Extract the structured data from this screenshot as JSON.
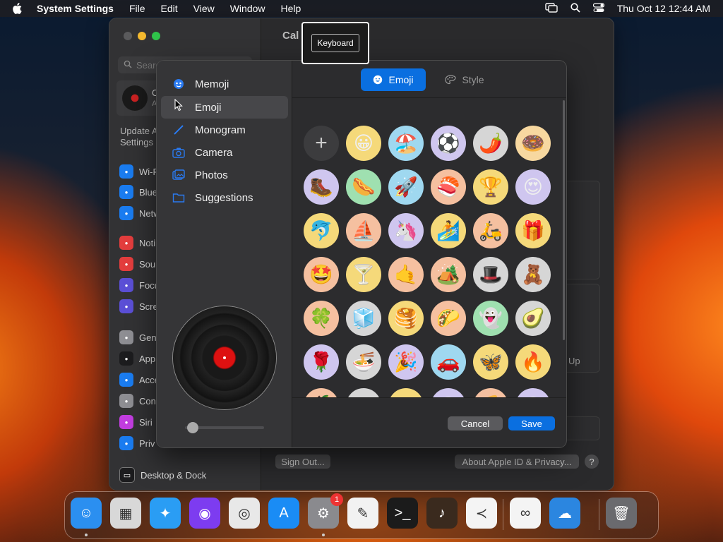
{
  "menubar": {
    "app_name": "System Settings",
    "menus": [
      "File",
      "Edit",
      "View",
      "Window",
      "Help"
    ],
    "datetime": "Thu Oct 12  12:44 AM"
  },
  "settings": {
    "search_placeholder": "Search",
    "content_title": "Cal",
    "profile_line1": "C",
    "profile_line2": "A",
    "update_text": "Update A Settings",
    "sidebar": [
      {
        "label": "Wi-F",
        "color": "#1a7cf0",
        "icon": "wifi-icon"
      },
      {
        "label": "Blue",
        "color": "#1a7cf0",
        "icon": "bluetooth-icon"
      },
      {
        "label": "Netw",
        "color": "#1a7cf0",
        "icon": "network-icon"
      },
      {
        "label": "Noti",
        "color": "#e33d3d",
        "icon": "notifications-icon"
      },
      {
        "label": "Sou",
        "color": "#e33d3d",
        "icon": "sound-icon"
      },
      {
        "label": "Focu",
        "color": "#5b4fd6",
        "icon": "focus-icon"
      },
      {
        "label": "Scre",
        "color": "#5b4fd6",
        "icon": "screen-time-icon"
      },
      {
        "label": "Gen",
        "color": "#8e8e93",
        "icon": "general-icon"
      },
      {
        "label": "App",
        "color": "#1c1c1e",
        "icon": "appearance-icon"
      },
      {
        "label": "Acce",
        "color": "#1a7cf0",
        "icon": "accessibility-icon"
      },
      {
        "label": "Con",
        "color": "#8e8e93",
        "icon": "control-center-icon"
      },
      {
        "label": "Siri",
        "color": "#c23de0",
        "icon": "siri-icon"
      },
      {
        "label": "Priv",
        "color": "#1a7cf0",
        "icon": "privacy-icon"
      }
    ],
    "desktop_dock": "Desktop & Dock",
    "up_text": "Up",
    "sign_out": "Sign Out...",
    "about": "About Apple ID & Privacy...",
    "help": "?"
  },
  "tooltip": {
    "label": "Keyboard"
  },
  "dialog": {
    "categories": [
      {
        "label": "Memoji",
        "icon": "memoji-icon",
        "selected": false
      },
      {
        "label": "Emoji",
        "icon": "emoji-icon",
        "selected": true
      },
      {
        "label": "Monogram",
        "icon": "monogram-icon",
        "selected": false
      },
      {
        "label": "Camera",
        "icon": "camera-icon",
        "selected": false
      },
      {
        "label": "Photos",
        "icon": "photos-icon",
        "selected": false
      },
      {
        "label": "Suggestions",
        "icon": "suggestions-icon",
        "selected": false
      }
    ],
    "tab_emoji": "Emoji",
    "tab_style": "Style",
    "add_symbol": "+",
    "emoji_rows": [
      [
        "😀",
        "🏖️",
        "⚽",
        "🌶️",
        "🍩"
      ],
      [
        "🥾",
        "🌭",
        "🚀",
        "🍣",
        "🏆",
        "😍"
      ],
      [
        "🐬",
        "⛵",
        "🦄",
        "🏄",
        "🛵",
        "🎁"
      ],
      [
        "🤩",
        "🍸",
        "🤙",
        "🏕️",
        "🎩",
        "🧸"
      ],
      [
        "🍀",
        "🧊",
        "🥞",
        "🌮",
        "👻",
        "🥑"
      ],
      [
        "🌹",
        "🍜",
        "🎉",
        "🚗",
        "🦋",
        "🔥"
      ],
      [
        "🍎",
        "🏔️",
        "🐢",
        "😎",
        "🍕",
        "😊"
      ]
    ],
    "emoji_colors": [
      [
        "#f5d97a",
        "#9fd8f0",
        "#cfc6ef",
        "#d6d6d6",
        "#f7d8a0"
      ],
      [
        "#cfc6ef",
        "#9fe0b0",
        "#9fd8f0",
        "#f5c0a0",
        "#f5d97a",
        "#cfc6ef"
      ],
      [
        "#f5d97a",
        "#f5c0a0",
        "#cfc6ef",
        "#f5d97a",
        "#f5c0a0",
        "#f5d97a"
      ],
      [
        "#f5c0a0",
        "#f5d97a",
        "#f5c0a0",
        "#f5c0a0",
        "#d6d6d6",
        "#d6d6d6"
      ],
      [
        "#f5c0a0",
        "#d6d6d6",
        "#f5d97a",
        "#f5c0a0",
        "#9fe0b0",
        "#d6d6d6"
      ],
      [
        "#cfc6ef",
        "#d6d6d6",
        "#cfc6ef",
        "#9fd8f0",
        "#f5d97a",
        "#f5d97a"
      ],
      [
        "#f5c0a0",
        "#d6d6d6",
        "#f5d97a",
        "#cfc6ef",
        "#f5c0a0",
        "#cfc6ef"
      ]
    ],
    "cancel": "Cancel",
    "save": "Save",
    "zoom_level": 0.05
  },
  "dock": {
    "apps": [
      {
        "name": "finder-icon",
        "bg": "#2b8ff0",
        "glyph": "☺",
        "running": true
      },
      {
        "name": "launchpad-icon",
        "bg": "#d8d8d8",
        "glyph": "▦",
        "running": false
      },
      {
        "name": "safari-icon",
        "bg": "#2a9df4",
        "glyph": "✦",
        "running": false
      },
      {
        "name": "firefox-icon",
        "bg": "#7d3cf0",
        "glyph": "◉",
        "running": false
      },
      {
        "name": "chrome-icon",
        "bg": "#e8e8e8",
        "glyph": "◎",
        "running": false
      },
      {
        "name": "app-store-icon",
        "bg": "#1a8cf5",
        "glyph": "A",
        "running": false
      },
      {
        "name": "system-settings-icon",
        "bg": "#8a8a8e",
        "glyph": "⚙",
        "running": true,
        "badge": "1"
      },
      {
        "name": "textedit-icon",
        "bg": "#f2f2f2",
        "glyph": "✎",
        "running": false
      },
      {
        "name": "terminal-icon",
        "bg": "#1b1b1b",
        "glyph": ">_",
        "running": false
      },
      {
        "name": "garageband-icon",
        "bg": "#3a2a1e",
        "glyph": "♪",
        "running": false
      },
      {
        "name": "vscode-icon",
        "bg": "#f4f4f4",
        "glyph": "≺",
        "running": false
      },
      {
        "name": "visual-studio-icon",
        "bg": "#f4f4f4",
        "glyph": "∞",
        "running": false
      },
      {
        "name": "weather-icon",
        "bg": "#2b86e0",
        "glyph": "☁",
        "running": false
      },
      {
        "name": "trash-icon",
        "bg": "#6a6a6e",
        "glyph": "🗑",
        "running": false
      }
    ]
  }
}
